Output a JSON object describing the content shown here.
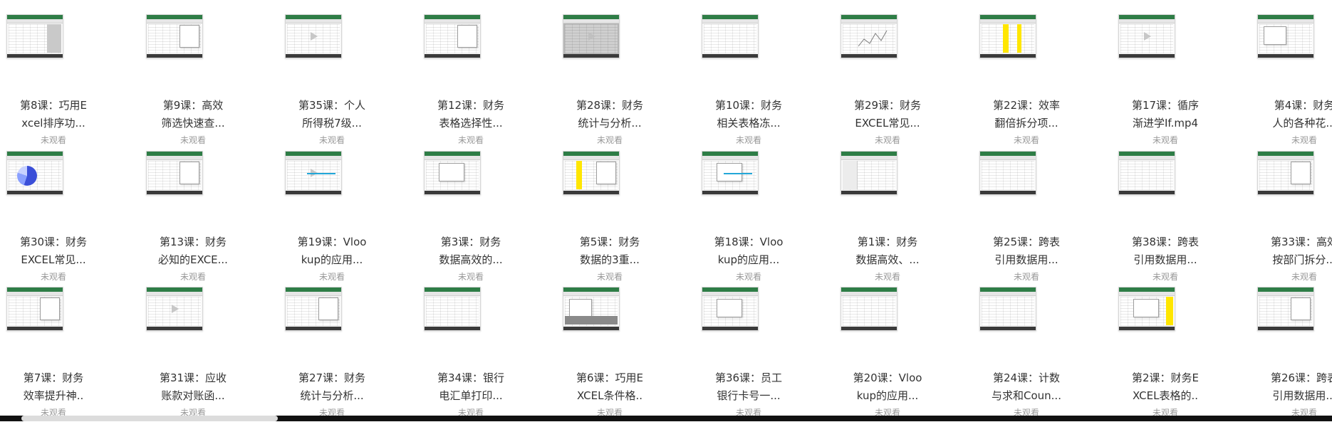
{
  "watch_status": "未观看",
  "rows": [
    [
      {
        "title_line1": "第8课：巧用E",
        "title_line2": "xcel排序功..."
      },
      {
        "title_line1": "第9课：高效",
        "title_line2": "筛选快速查..."
      },
      {
        "title_line1": "第35课：个人",
        "title_line2": "所得税7级..."
      },
      {
        "title_line1": "第12课：财务",
        "title_line2": "表格选择性..."
      },
      {
        "title_line1": "第28课：财务",
        "title_line2": "统计与分析..."
      },
      {
        "title_line1": "第10课：财务",
        "title_line2": "相关表格冻..."
      },
      {
        "title_line1": "第29课：财务",
        "title_line2": "EXCEL常见..."
      },
      {
        "title_line1": "第22课：效率",
        "title_line2": "翻倍拆分项..."
      },
      {
        "title_line1": "第17课：循序",
        "title_line2": "渐进学If.mp4"
      },
      {
        "title_line1": "第4课：财务",
        "title_line2": "人的各种花..."
      }
    ],
    [
      {
        "title_line1": "第30课：财务",
        "title_line2": "EXCEL常见..."
      },
      {
        "title_line1": "第13课：财务",
        "title_line2": "必知的EXCE..."
      },
      {
        "title_line1": "第19课：Vloo",
        "title_line2": "kup的应用..."
      },
      {
        "title_line1": "第3课：财务",
        "title_line2": "数据高效的..."
      },
      {
        "title_line1": "第5课：财务",
        "title_line2": "数据的3重..."
      },
      {
        "title_line1": "第18课：Vloo",
        "title_line2": "kup的应用..."
      },
      {
        "title_line1": "第1课：财务",
        "title_line2": "数据高效、..."
      },
      {
        "title_line1": "第25课：跨表",
        "title_line2": "引用数据用..."
      },
      {
        "title_line1": "第38课：跨表",
        "title_line2": "引用数据用..."
      },
      {
        "title_line1": "第33课：高效",
        "title_line2": "按部门拆分..."
      }
    ],
    [
      {
        "title_line1": "第7课：财务",
        "title_line2": "效率提升神.."
      },
      {
        "title_line1": "第31课：应收",
        "title_line2": "账款对账函..."
      },
      {
        "title_line1": "第27课：财务",
        "title_line2": "统计与分析..."
      },
      {
        "title_line1": "第34课：银行",
        "title_line2": "电汇单打印..."
      },
      {
        "title_line1": "第6课：巧用E",
        "title_line2": "XCEL条件格.."
      },
      {
        "title_line1": "第36课：员工",
        "title_line2": "银行卡号一..."
      },
      {
        "title_line1": "第20课：Vloo",
        "title_line2": "kup的应用..."
      },
      {
        "title_line1": "第24课：计数",
        "title_line2": "与求和Coun..."
      },
      {
        "title_line1": "第2课：财务E",
        "title_line2": "XCEL表格的.."
      },
      {
        "title_line1": "第26课：跨表",
        "title_line2": "引用数据用..."
      }
    ]
  ]
}
